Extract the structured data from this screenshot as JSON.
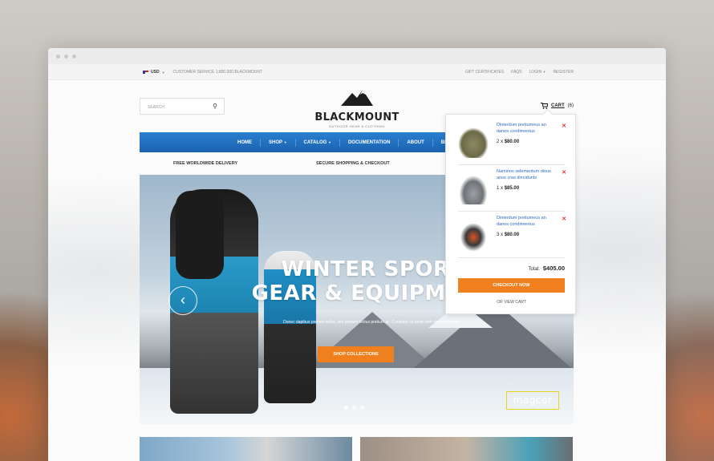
{
  "topbar": {
    "currency": "USD",
    "customer_service": "CUSTOMER SERVICE 1.800.000.BLACKMOUNT",
    "gift_certificates": "GIFT CERTIFICATES",
    "faqs": "FAQS",
    "login": "LOGIN",
    "register": "REGISTER"
  },
  "search": {
    "placeholder": "SEARCH"
  },
  "logo": {
    "name": "BLACKMOUNT",
    "tagline": "OUTDOOR GEAR & CLOTHING"
  },
  "cart": {
    "label": "CART",
    "count": "(6)"
  },
  "nav": {
    "items": [
      "HOME",
      "SHOP",
      "CATALOG",
      "DOCUMENTATION",
      "ABOUT",
      "BLOG"
    ]
  },
  "features": {
    "delivery": "FREE WORLDWIDE DELIVERY",
    "secure": "SECURE SHOPPING & CHECKOUT"
  },
  "hero": {
    "title_line1": "WINTER SPORT",
    "title_line2": "GEAR & EQUIPMENT",
    "subtitle": "Donec dapibus pretium tellus, sed pretium lectus pretium ac. Curabitur sit amet nibh dapibus rutrum.",
    "cta": "SHOP COLLECTIONS",
    "watermark": "magcor",
    "prev_arrow": "‹"
  },
  "cart_dropdown": {
    "items": [
      {
        "name": "Dinterdum pretiumeus an danos condimentus",
        "qty_price": "2 x",
        "price": "$80.00",
        "image": "backpack"
      },
      {
        "name": "Naminos selementum dious anos cras dincidunts",
        "qty_price": "1 x",
        "price": "$85.00",
        "image": "hiking-shoe"
      },
      {
        "name": "Dinterdum pretiumeus an danos condimentus",
        "qty_price": "3 x",
        "price": "$80.00",
        "image": "ski-goggles"
      }
    ],
    "total_label": "Total:",
    "total_value": "$405.00",
    "checkout": "CHECKOUT NOW",
    "view_cart": "OR VIEW CART"
  },
  "colors": {
    "accent": "#f07f1d",
    "nav_blue": "#1a62b0",
    "link_blue": "#2a6bc1"
  }
}
